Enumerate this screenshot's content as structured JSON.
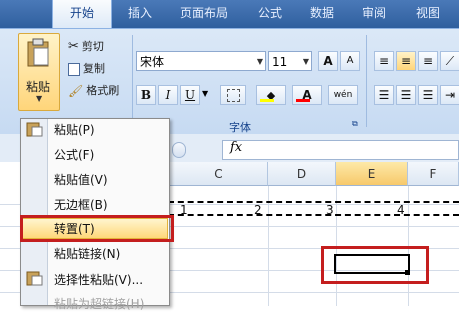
{
  "ribbon_tabs": [
    "开始",
    "插入",
    "页面布局",
    "公式",
    "数据",
    "审阅",
    "视图"
  ],
  "clipboard": {
    "paste_label": "粘贴",
    "cut_label": "剪切",
    "copy_label": "复制",
    "format_painter_label": "格式刷",
    "paste_icon": "clipboard-icon",
    "cut_icon": "scissors-icon",
    "copy_icon": "copy-icon",
    "format_painter_icon": "paintbrush-icon"
  },
  "font": {
    "group_label": "字体",
    "font_name": "宋体",
    "font_size": "11",
    "bold": "B",
    "italic": "I",
    "underline": "U",
    "grow": "A",
    "shrink": "A",
    "font_color": "A",
    "phonetic": "wén",
    "fill_color": "#ffff00",
    "font_color_hex": "#ff0000"
  },
  "formula_bar": {
    "fx_label": "fx"
  },
  "columns": [
    "C",
    "D",
    "E",
    "F"
  ],
  "row_values": [
    "1",
    "2",
    "3",
    "4"
  ],
  "paste_menu": {
    "items": [
      {
        "label": "粘贴(P)",
        "icon": "paste-icon",
        "enabled": true
      },
      {
        "label": "公式(F)",
        "icon": "",
        "enabled": true
      },
      {
        "label": "粘贴值(V)",
        "icon": "",
        "enabled": true
      },
      {
        "label": "无边框(B)",
        "icon": "",
        "enabled": true
      },
      {
        "label": "转置(T)",
        "icon": "",
        "enabled": true
      },
      {
        "label": "粘贴链接(N)",
        "icon": "",
        "enabled": true
      },
      {
        "label": "选择性粘贴(V)...",
        "icon": "paste-special-icon",
        "enabled": true
      },
      {
        "label": "粘贴为超链接(H)",
        "icon": "",
        "enabled": false
      }
    ],
    "highlighted_index": 4
  },
  "colors": {
    "highlight_box": "#c41e1e",
    "selected_column": "#f7c96b"
  }
}
